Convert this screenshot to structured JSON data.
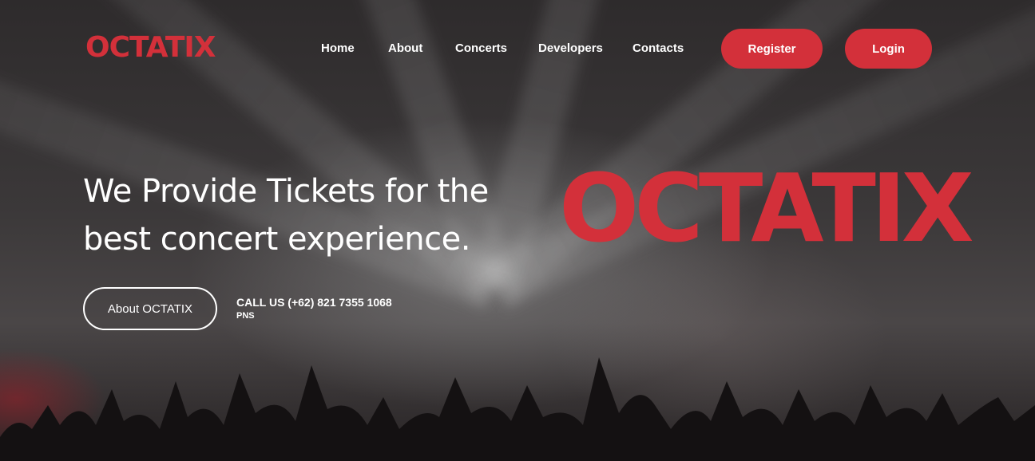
{
  "brand": {
    "logo_text": "OCTATIX",
    "accent_color": "#d3303a"
  },
  "nav": {
    "items": [
      "Home",
      "About",
      "Concerts",
      "Developers",
      "Contacts"
    ],
    "register_label": "Register",
    "login_label": "Login"
  },
  "hero": {
    "headline_line1": "We Provide Tickets for the",
    "headline_line2": "best concert experience.",
    "about_button": "About OCTATIX",
    "call_text": "CALL US (+62) 821 7355 1068",
    "call_sub": "PNS",
    "big_logo_text": "OCTATIX"
  }
}
